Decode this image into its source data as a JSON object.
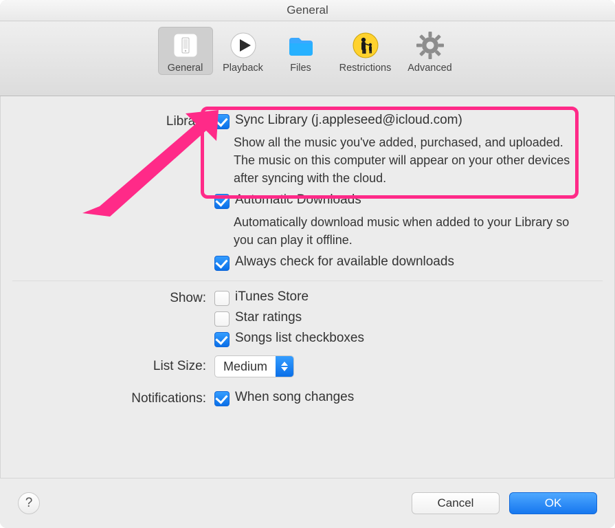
{
  "title": "General",
  "toolbar": {
    "items": [
      {
        "label": "General"
      },
      {
        "label": "Playback"
      },
      {
        "label": "Files"
      },
      {
        "label": "Restrictions"
      },
      {
        "label": "Advanced"
      }
    ],
    "selected": 0
  },
  "sections": {
    "library_label": "Library",
    "sync": {
      "label": "Sync Library (j.appleseed@icloud.com)",
      "checked": true,
      "desc": "Show all the music you've added, purchased, and uploaded. The music on this computer will appear on your other devices after syncing with the cloud."
    },
    "auto_dl": {
      "label": "Automatic Downloads",
      "checked": true,
      "desc": "Automatically download music when added to your Library so you can play it offline."
    },
    "always_check": {
      "label": "Always check for available downloads",
      "checked": true
    },
    "show_label": "Show:",
    "itunes_store": {
      "label": "iTunes Store",
      "checked": false
    },
    "star_ratings": {
      "label": "Star ratings",
      "checked": false
    },
    "songs_checkboxes": {
      "label": "Songs list checkboxes",
      "checked": true
    },
    "list_size_label": "List Size:",
    "list_size_value": "Medium",
    "notifications_label": "Notifications:",
    "song_changes": {
      "label": "When song changes",
      "checked": true
    }
  },
  "footer": {
    "help": "?",
    "cancel": "Cancel",
    "ok": "OK"
  }
}
